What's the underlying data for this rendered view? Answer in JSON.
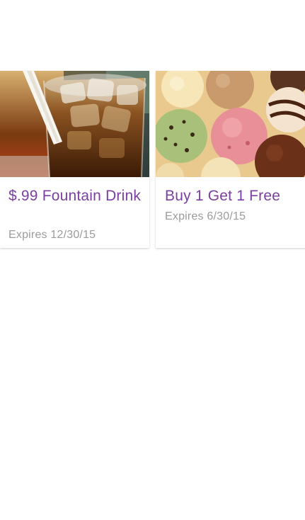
{
  "offers": [
    {
      "title": "$.99 Fountain Drink",
      "expires": "Expires 12/30/15",
      "image": "fountain-drink-photo"
    },
    {
      "title": "Buy 1 Get 1 Free",
      "expires": "Expires 6/30/15",
      "image": "ice-cream-scoops-photo"
    }
  ],
  "colors": {
    "title": "#7a3fa0",
    "expiry": "#9b9b9b",
    "background": "#ffffff"
  }
}
